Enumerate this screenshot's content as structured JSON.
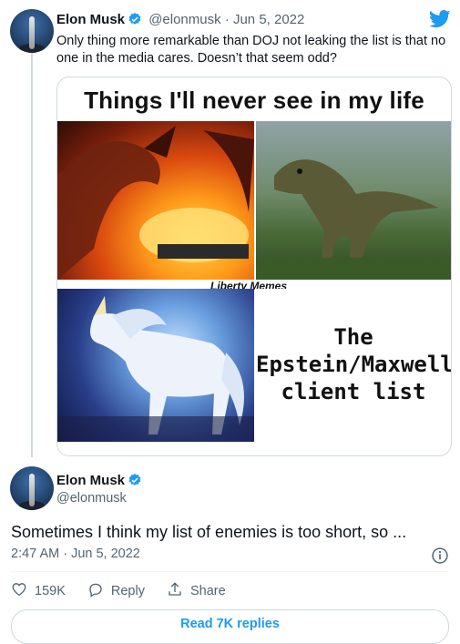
{
  "tweet": {
    "author_name": "Elon Musk",
    "author_handle": "@elonmusk",
    "separator": "·",
    "date": "Jun 5, 2022",
    "text": "Only thing more remarkable than DOJ not leaking the list is that no one in the media cares. Doesn’t that seem odd?",
    "media": {
      "title": "Things I'll never see in my life",
      "watermark": "Liberty Memes",
      "panel_text_line1": "The",
      "panel_text_line2": "Epstein/Maxwell",
      "panel_text_line3": "client list"
    }
  },
  "reply": {
    "author_name": "Elon Musk",
    "author_handle": "@elonmusk",
    "text": "Sometimes I think my list of enemies is too short, so ...",
    "timestamp": "2:47 AM · Jun 5, 2022",
    "likes": "159K",
    "reply_label": "Reply",
    "share_label": "Share",
    "read_replies": "Read 7K replies"
  },
  "colors": {
    "accent": "#1d9bf0",
    "text": "#0f1419",
    "muted": "#536471"
  },
  "icons": [
    "verified-badge-icon",
    "twitter-bird-icon",
    "info-icon",
    "heart-icon",
    "reply-icon",
    "share-icon"
  ]
}
